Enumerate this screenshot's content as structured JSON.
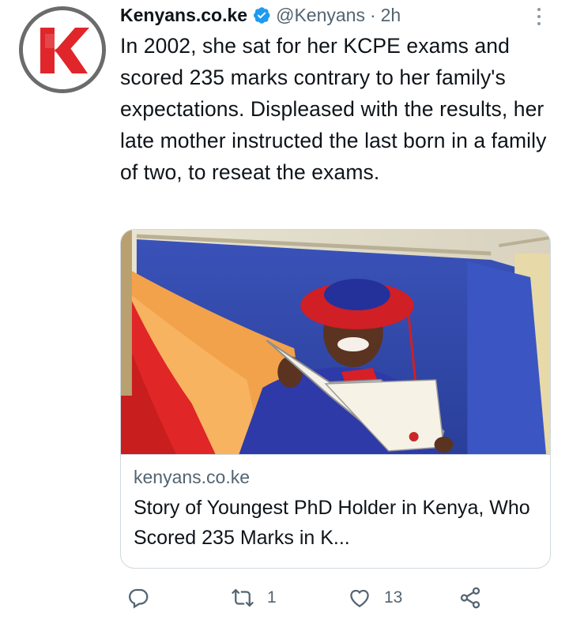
{
  "author": {
    "display_name": "Kenyans.co.ke",
    "handle": "@Kenyans",
    "separator": "·",
    "time": "2h",
    "avatar_letter": "K",
    "verified": true
  },
  "tweet": {
    "text": "In 2002, she sat for her KCPE exams and scored 235 marks contrary to her family's expectations. Displeased with the results, her late mother instructed the last born in a family of two, to reseat the exams."
  },
  "card": {
    "domain": "kenyans.co.ke",
    "title": "Story of Youngest PhD Holder in Kenya, Who Scored 235 Marks in K..."
  },
  "actions": {
    "reply_count": "",
    "retweet_count": "1",
    "like_count": "13"
  },
  "colors": {
    "brand_red": "#e0262b",
    "verified_blue": "#1d9bf0",
    "muted_text": "#536471",
    "border": "#cfd9de"
  },
  "icons": [
    "k-logo",
    "verified-badge-icon",
    "more-icon",
    "reply-icon",
    "retweet-icon",
    "like-icon",
    "share-icon"
  ]
}
